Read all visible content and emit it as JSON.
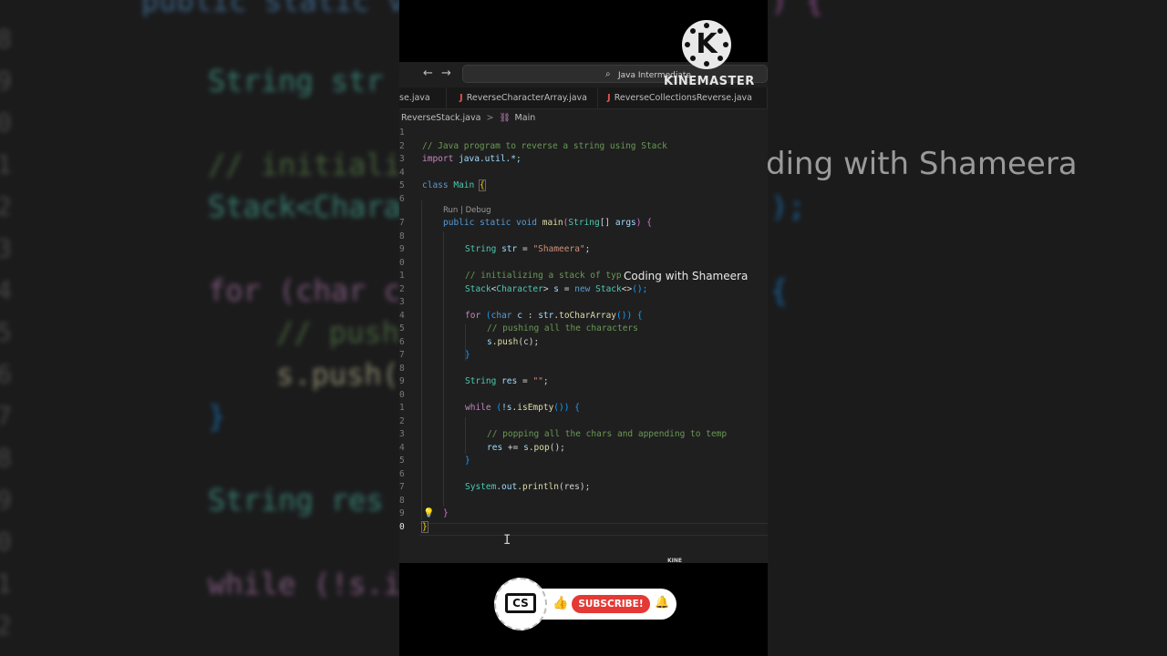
{
  "background": {
    "line_numbers": [
      "8",
      "9",
      "0",
      "1",
      "2",
      "3",
      "4",
      "5",
      "6",
      "7",
      "8",
      "9",
      "0",
      "1",
      "2"
    ],
    "lines": [
      {
        "text": "public static vo",
        "color": "#569cd6"
      },
      {
        "text": "String str =",
        "color": "#4ec9b0"
      },
      {
        "text": "// initializ",
        "color": "#6a9955"
      },
      {
        "text": "Stack<Charac",
        "color": "#4ec9b0"
      },
      {
        "text": "for (char c",
        "color": "#c586c0"
      },
      {
        "text": "// push",
        "color": "#6a9955"
      },
      {
        "text": "s.push(",
        "color": "#dcdcaa"
      },
      {
        "text": "}",
        "color": "#179fff"
      },
      {
        "text": "String res",
        "color": "#4ec9b0"
      },
      {
        "text": "while (!s.i",
        "color": "#c586c0"
      },
      {
        "text": ") {",
        "color": "#da70d6"
      },
      {
        "text": ");",
        "color": "#179fff"
      },
      {
        "text": "{",
        "color": "#179fff"
      }
    ],
    "watermark": "ding with Shameera"
  },
  "kinemaster": {
    "logo_letter": "K",
    "label": "KINEMASTER",
    "small_label": "KINE"
  },
  "titlebar": {
    "back_icon": "arrow-left-icon",
    "forward_icon": "arrow-right-icon",
    "search_icon": "search-icon",
    "search_text": "Java Intermediate"
  },
  "tabs": [
    {
      "label": "se.java",
      "icon": ""
    },
    {
      "label": "ReverseCharacterArray.java",
      "icon": "J"
    },
    {
      "label": "ReverseCollectionsReverse.java",
      "icon": "J"
    }
  ],
  "breadcrumb": {
    "file": "ReverseStack.java",
    "separator": ">",
    "symbol_icon": "class-symbol-icon",
    "symbol": "Main"
  },
  "code": {
    "line_numbers": [
      "1",
      "2",
      "3",
      "4",
      "5",
      "6",
      "7",
      "8",
      "9",
      "0",
      "1",
      "2",
      "3",
      "4",
      "5",
      "6",
      "7",
      "8",
      "9",
      "0",
      "1",
      "2",
      "3",
      "4",
      "5",
      "6",
      "7",
      "8",
      "9",
      "0"
    ],
    "codelens": "Run | Debug",
    "lines": {
      "l2": "// Java program to reverse a string using Stack",
      "l3a": "import",
      "l3b": "java.util.*;",
      "l5a": "class",
      "l5b": "Main",
      "l5c": "{",
      "l7a": "public",
      "l7b": "static",
      "l7c": "void",
      "l7d": "main",
      "l7e": "(",
      "l7f": "String",
      "l7g": "[]",
      "l7h": "args",
      "l7i": ")",
      "l7j": "{",
      "l9a": "String",
      "l9b": "str",
      "l9c": "=",
      "l9d": "\"Shameera\"",
      "l9e": ";",
      "l11": "// initializing a stack of typ",
      "l12a": "Stack",
      "l12b": "<",
      "l12c": "Character",
      "l12d": ">",
      "l12e": "s",
      "l12f": "=",
      "l12g": "new",
      "l12h": "Stack",
      "l12i": "<>",
      "l12j": "();",
      "l14a": "for",
      "l14b": "(",
      "l14c": "char",
      "l14d": "c",
      "l14e": ":",
      "l14f": "str",
      "l14g": ".toCharArray",
      "l14h": "())",
      "l14i": "{",
      "l15": "// pushing all the characters",
      "l16a": "s",
      "l16b": ".push",
      "l16c": "(c);",
      "l17": "}",
      "l19a": "String",
      "l19b": "res",
      "l19c": "=",
      "l19d": "\"\"",
      "l19e": ";",
      "l21a": "while",
      "l21b": "(",
      "l21c": "!s",
      "l21d": ".isEmpty",
      "l21e": "())",
      "l21f": "{",
      "l23": "// popping all the chars and appending to temp",
      "l24a": "res",
      "l24b": "+=",
      "l24c": "s",
      "l24d": ".pop",
      "l24e": "();",
      "l25": "}",
      "l27a": "System",
      "l27b": ".out",
      "l27c": ".println",
      "l27d": "(res);",
      "l29": "}",
      "l30": "}"
    }
  },
  "overlay": {
    "watermark": "Coding with Shameera"
  },
  "subscribe": {
    "logo_text": "CS",
    "like_icon": "thumbs-up-icon",
    "button_label": "SUBSCRIBE!",
    "bell_icon": "bell-icon"
  }
}
